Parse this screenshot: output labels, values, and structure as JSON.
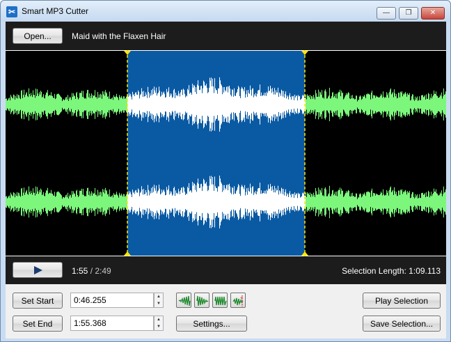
{
  "window": {
    "title": "Smart MP3 Cutter",
    "minimize_icon": "minimize-icon",
    "maximize_icon": "maximize-icon",
    "close_icon": "close-icon"
  },
  "toolbar": {
    "open_label": "Open...",
    "file_title": "Maid with the Flaxen Hair"
  },
  "waveform": {
    "channels": 2,
    "selection_start_fraction": 0.276,
    "selection_end_fraction": 0.68,
    "colors": {
      "background": "#000000",
      "wave": "#7cf77c",
      "selection_fill": "#0a5aa3",
      "selection_wave": "#ffffff",
      "marker": "#ffe600"
    }
  },
  "transport": {
    "play_icon": "play-icon",
    "current_time": "1:55",
    "separator": " / ",
    "total_time": "2:49",
    "selection_length_label": "Selection Length: 1:09.113"
  },
  "controls": {
    "set_start_label": "Set Start",
    "start_value": "0:46.255",
    "set_end_label": "Set End",
    "end_value": "1:55.368",
    "settings_label": "Settings...",
    "play_selection_label": "Play Selection",
    "save_selection_label": "Save Selection...",
    "tool_icons": [
      "fade-in-icon",
      "fade-out-icon",
      "normalize-icon",
      "add-marker-icon"
    ]
  }
}
